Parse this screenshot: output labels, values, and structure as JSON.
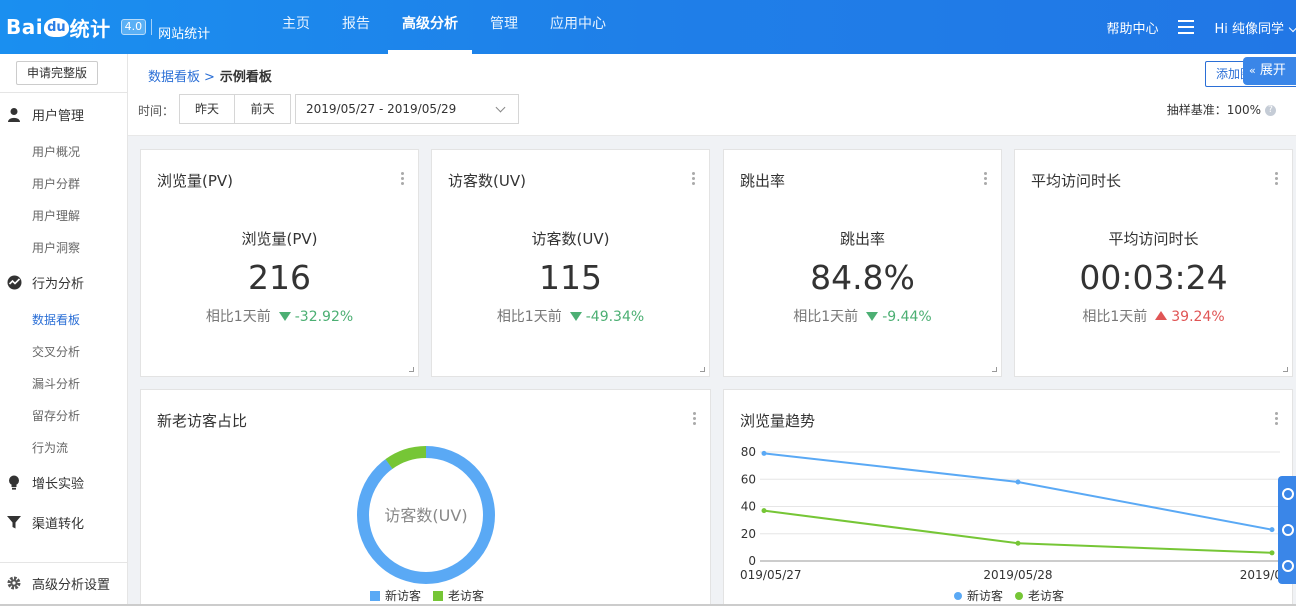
{
  "brand": {
    "logo_text_left": "Bai",
    "logo_text_du": "du",
    "logo_text_right": "统计",
    "version": "4.0",
    "product": "网站统计"
  },
  "nav": {
    "items": [
      "主页",
      "报告",
      "高级分析",
      "管理",
      "应用中心"
    ],
    "active_index": 2
  },
  "topright": {
    "help": "帮助中心",
    "user": "Hi 纯像同学"
  },
  "sidebar": {
    "apply_button": "申请完整版",
    "groups": [
      {
        "label": "用户管理",
        "icon": "user-icon",
        "items": [
          "用户概况",
          "用户分群",
          "用户理解",
          "用户洞察"
        ]
      },
      {
        "label": "行为分析",
        "icon": "behavior-icon",
        "items": [
          "数据看板",
          "交叉分析",
          "漏斗分析",
          "留存分析",
          "行为流"
        ]
      },
      {
        "label": "增长实验",
        "icon": "bulb-icon",
        "items": []
      },
      {
        "label": "渠道转化",
        "icon": "funnel-icon",
        "items": []
      }
    ],
    "active_item": "数据看板",
    "settings": "高级分析设置"
  },
  "header": {
    "breadcrumb_link": "数据看板",
    "breadcrumb_sep": ">",
    "breadcrumb_current": "示例看板",
    "time_label": "时间：",
    "yesterday": "昨天",
    "day_before": "前天",
    "date_range": "2019/05/27 - 2019/05/29",
    "add_button": "添加图表",
    "expand": "展开",
    "sample_label": "抽样基准：100%"
  },
  "kpis": [
    {
      "title": "浏览量(PV)",
      "sub": "浏览量(PV)",
      "value": "216",
      "compare": "相比1天前",
      "change": "-32.92%",
      "trend": "down"
    },
    {
      "title": "访客数(UV)",
      "sub": "访客数(UV)",
      "value": "115",
      "compare": "相比1天前",
      "change": "-49.34%",
      "trend": "down"
    },
    {
      "title": "跳出率",
      "sub": "跳出率",
      "value": "84.8%",
      "compare": "相比1天前",
      "change": "-9.44%",
      "trend": "down"
    },
    {
      "title": "平均访问时长",
      "sub": "平均访问时长",
      "value": "00:03:24",
      "compare": "相比1天前",
      "change": "39.24%",
      "trend": "up"
    }
  ],
  "donut": {
    "title": "新老访客占比",
    "center_label": "访客数(UV)",
    "legend": [
      "新访客",
      "老访客"
    ],
    "shares": [
      0.9,
      0.1
    ],
    "colors": [
      "#5aa9f5",
      "#76c636"
    ]
  },
  "chart_data": {
    "type": "line",
    "title": "浏览量趋势",
    "x": [
      "2019/05/27",
      "2019/05/28",
      "2019/05/29"
    ],
    "x_tick_labels": [
      "019/05/27",
      "2019/05/28",
      "2019/0"
    ],
    "ylim": [
      0,
      80
    ],
    "yticks": [
      0,
      20,
      40,
      60,
      80
    ],
    "series": [
      {
        "name": "新访客",
        "color": "#5aa9f5",
        "values": [
          79,
          58,
          23
        ]
      },
      {
        "name": "老访客",
        "color": "#76c636",
        "values": [
          37,
          13,
          6
        ]
      }
    ],
    "legend": "bottom"
  }
}
